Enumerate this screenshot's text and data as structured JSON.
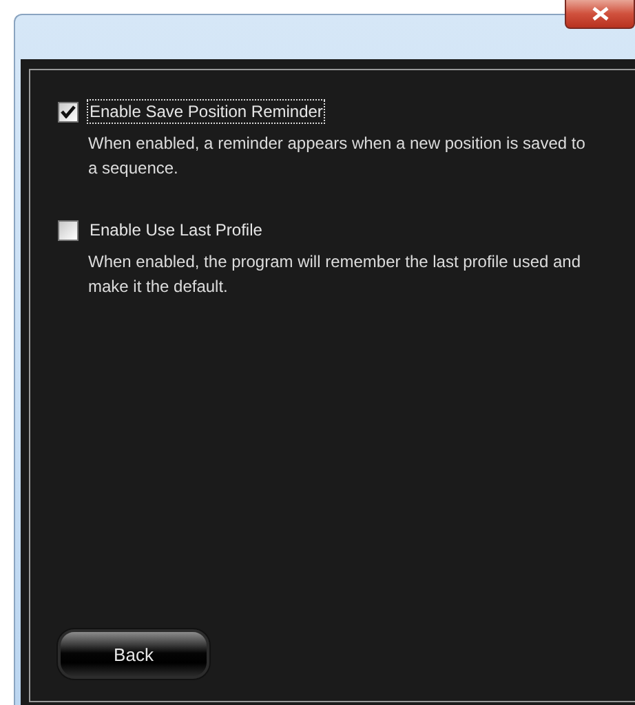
{
  "options": [
    {
      "label": "Enable Save Position Reminder",
      "checked": true,
      "focused": true,
      "description": "When enabled, a reminder appears when a new position is saved to a sequence."
    },
    {
      "label": "Enable Use Last Profile",
      "checked": false,
      "focused": false,
      "description": "When enabled, the program will remember the last profile used and make it the default."
    }
  ],
  "back_button": "Back"
}
